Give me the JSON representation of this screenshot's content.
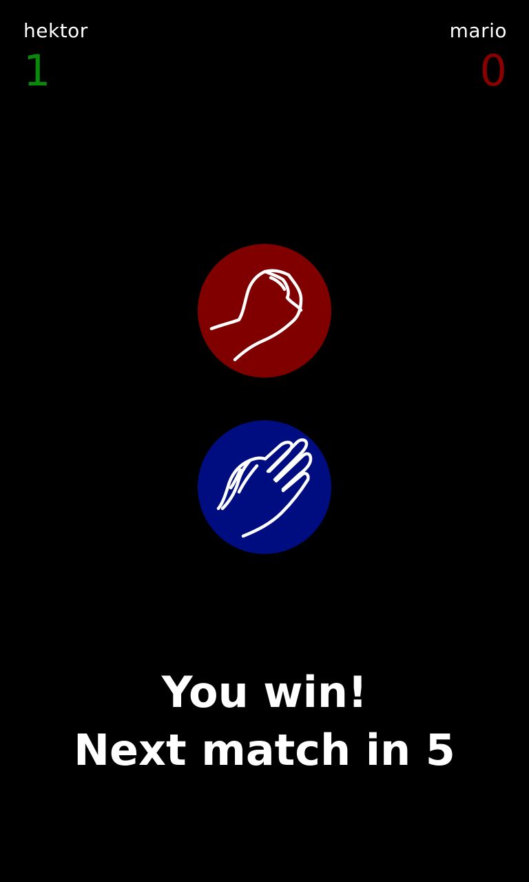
{
  "players": {
    "left": {
      "name": "hektor",
      "score": "1",
      "score_color": "#0a8a0a"
    },
    "right": {
      "name": "mario",
      "score": "0",
      "score_color": "#8a0000"
    }
  },
  "choices": {
    "opponent": {
      "icon": "rock-fist-icon",
      "color": "#800000"
    },
    "player": {
      "icon": "paper-hand-icon",
      "color": "#000d80"
    }
  },
  "result": {
    "headline": "You win!",
    "countdown": "Next match in 5"
  }
}
